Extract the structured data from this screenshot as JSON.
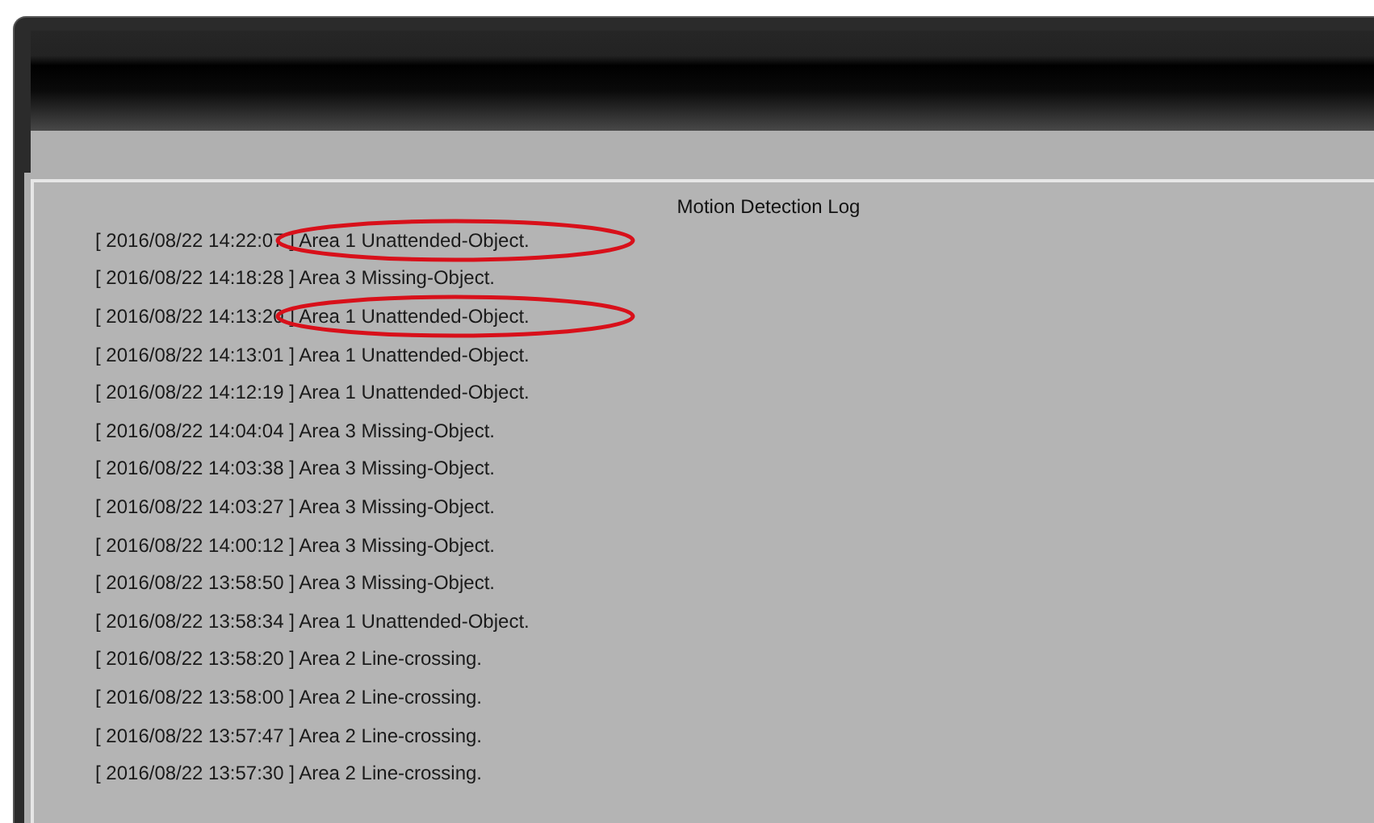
{
  "log": {
    "title": "Motion Detection Log",
    "entries": [
      {
        "text": "[ 2016/08/22 14:22:07 ] Area 1 Unattended-Object.",
        "circled": true
      },
      {
        "text": "[ 2016/08/22 14:18:28 ] Area 3 Missing-Object.",
        "circled": false
      },
      {
        "text": "[ 2016/08/22 14:13:20 ] Area 1 Unattended-Object.",
        "circled": true
      },
      {
        "text": "[ 2016/08/22 14:13:01 ] Area 1 Unattended-Object.",
        "circled": false
      },
      {
        "text": "[ 2016/08/22 14:12:19 ] Area 1 Unattended-Object.",
        "circled": false
      },
      {
        "text": "[ 2016/08/22 14:04:04 ] Area 3 Missing-Object.",
        "circled": false
      },
      {
        "text": "[ 2016/08/22 14:03:38 ] Area 3 Missing-Object.",
        "circled": false
      },
      {
        "text": "[ 2016/08/22 14:03:27 ] Area 3 Missing-Object.",
        "circled": false
      },
      {
        "text": "[ 2016/08/22 14:00:12 ] Area 3 Missing-Object.",
        "circled": false
      },
      {
        "text": "[ 2016/08/22 13:58:50 ] Area 3 Missing-Object.",
        "circled": false
      },
      {
        "text": "[ 2016/08/22 13:58:34 ] Area 1 Unattended-Object.",
        "circled": false
      },
      {
        "text": "[ 2016/08/22 13:58:20 ] Area 2 Line-crossing.",
        "circled": false
      },
      {
        "text": "[ 2016/08/22 13:58:00 ] Area 2 Line-crossing.",
        "circled": false
      },
      {
        "text": "[ 2016/08/22 13:57:47 ] Area 2 Line-crossing.",
        "circled": false
      },
      {
        "text": "[ 2016/08/22 13:57:30 ] Area 2 Line-crossing.",
        "circled": false
      }
    ]
  }
}
